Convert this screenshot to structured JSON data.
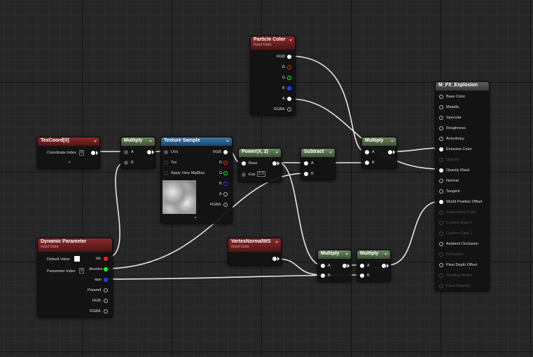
{
  "graph": {
    "texcoord": {
      "title": "TexCoord[0]",
      "coordinate_index_label": "Coordinate Index",
      "coordinate_index_value": "0"
    },
    "multiply1": {
      "title": "Multiply",
      "a": "A",
      "b": "B"
    },
    "texture_sample": {
      "title": "Texture Sample",
      "uvs": "UVs",
      "tex": "Tex",
      "apply_mip": "Apply View MipBias",
      "out_rgb": "RGB",
      "out_r": "R",
      "out_g": "G",
      "out_b": "B",
      "out_a": "A",
      "out_rgba": "RGBA"
    },
    "particle_color": {
      "title": "Particle Color",
      "subtitle": "Input Data",
      "rgb": "RGB",
      "r": "R",
      "g": "G",
      "b": "B",
      "a": "A",
      "rgba": "RGBA"
    },
    "power": {
      "title": "Power(X, 2)",
      "base": "Base",
      "exp": "Exp",
      "exp_value": "2.0"
    },
    "subtract": {
      "title": "Subtract",
      "a": "A",
      "b": "B"
    },
    "multiply2": {
      "title": "Multiply",
      "a": "A",
      "b": "B"
    },
    "dynamic_parameter": {
      "title": "Dynamic Parameter",
      "subtitle": "Input Data",
      "default_value": "Default Value",
      "parameter_index": "Parameter Index",
      "parameter_index_value": "0",
      "out_tile": "tile",
      "out_dissolve": "dissolve",
      "out_wpo": "wpo",
      "out_param4": "Param4",
      "out_rgb": "RGB",
      "out_rgba": "RGBA"
    },
    "vertex_normal": {
      "title": "VertexNormalWS",
      "subtitle": "Input Data"
    },
    "multiply3": {
      "title": "Multiply",
      "a": "A",
      "b": "B"
    },
    "multiply4": {
      "title": "Multiply",
      "a": "A",
      "b": "B"
    },
    "material": {
      "title": "M_FX_Explosion",
      "inputs": [
        {
          "label": "Base Color",
          "enabled": true
        },
        {
          "label": "Metallic",
          "enabled": true
        },
        {
          "label": "Specular",
          "enabled": true
        },
        {
          "label": "Roughness",
          "enabled": true
        },
        {
          "label": "Anisotropy",
          "enabled": true
        },
        {
          "label": "Emissive Color",
          "enabled": true,
          "connected": true
        },
        {
          "label": "Opacity",
          "enabled": false
        },
        {
          "label": "Opacity Mask",
          "enabled": true,
          "connected": true
        },
        {
          "label": "Normal",
          "enabled": true
        },
        {
          "label": "Tangent",
          "enabled": true
        },
        {
          "label": "World Position Offset",
          "enabled": true,
          "connected": true
        },
        {
          "label": "Subsurface Color",
          "enabled": false
        },
        {
          "label": "Custom Data 0",
          "enabled": false
        },
        {
          "label": "Custom Data 1",
          "enabled": false
        },
        {
          "label": "Ambient Occlusion",
          "enabled": true
        },
        {
          "label": "Refraction",
          "enabled": false
        },
        {
          "label": "Pixel Depth Offset",
          "enabled": true
        },
        {
          "label": "Shading Model",
          "enabled": false
        },
        {
          "label": "Front Material",
          "enabled": false
        }
      ]
    },
    "colors": {
      "header_red": "#8e2a2a",
      "header_green": "#6c8a60",
      "header_blue": "#3a7bb0",
      "pin_red": "#ff2020",
      "pin_green": "#20ff20",
      "pin_blue": "#2040ff",
      "wire": "#e8e8e8"
    }
  }
}
